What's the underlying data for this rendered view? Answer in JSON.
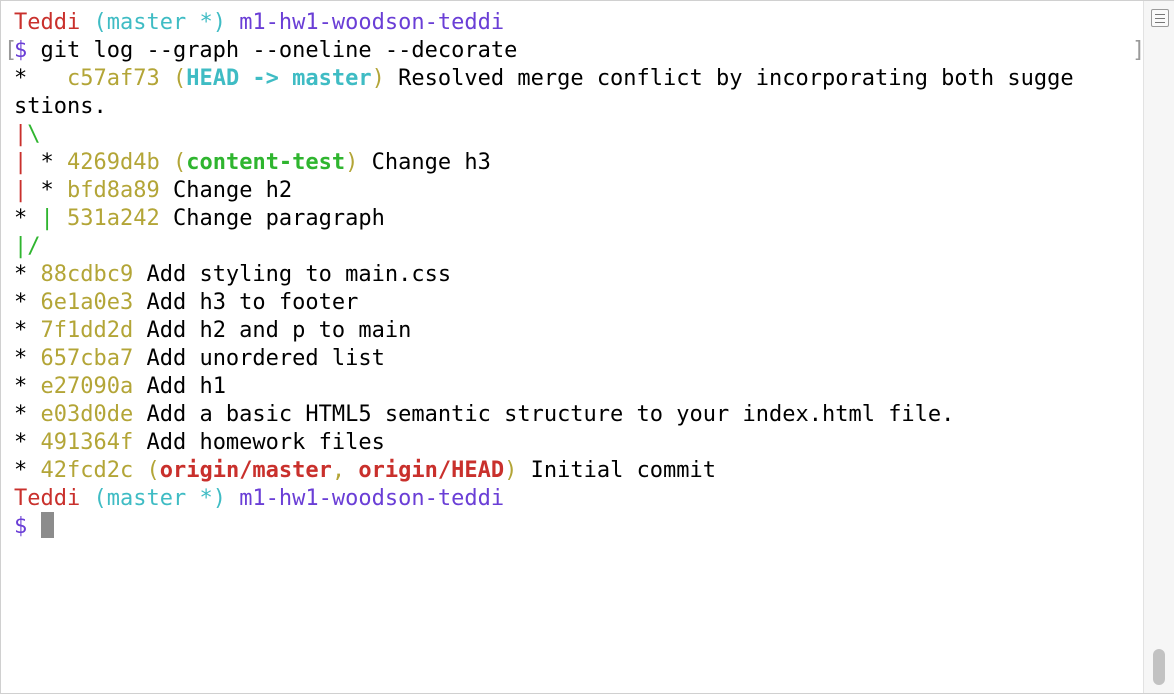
{
  "terminal": {
    "prompt1": {
      "user": "Teddi",
      "branch": "(master *)",
      "dir": "m1-hw1-woodson-teddi"
    },
    "command": {
      "dollar": "$",
      "text": " git log --graph --oneline --decorate"
    },
    "commit_head": {
      "graph": "*   ",
      "hash": "c57af73",
      "paren_open": " (",
      "head_ref": "HEAD -> master",
      "paren_close": ")",
      "message": " Resolved merge conflict by incorporating both sugge"
    },
    "commit_head_wrap": "stions.",
    "graph_merge": {
      "pipe": "|",
      "backslash": "\\"
    },
    "commit_content": {
      "pipe": "|",
      "graph": " * ",
      "hash": "4269d4b",
      "paren_open": " (",
      "ref": "content-test",
      "paren_close": ")",
      "message": " Change h3"
    },
    "commit_h2": {
      "pipe": "|",
      "graph": " * ",
      "hash": "bfd8a89",
      "message": " Change h2"
    },
    "commit_paragraph": {
      "star": "* ",
      "pipe": "|",
      "hash": " 531a242",
      "message": " Change paragraph"
    },
    "graph_split": {
      "pipe": "|",
      "slash": "/"
    },
    "commits": [
      {
        "graph": "* ",
        "hash": "88cdbc9",
        "message": " Add styling to main.css"
      },
      {
        "graph": "* ",
        "hash": "6e1a0e3",
        "message": " Add h3 to footer"
      },
      {
        "graph": "* ",
        "hash": "7f1dd2d",
        "message": " Add h2 and p to main"
      },
      {
        "graph": "* ",
        "hash": "657cba7",
        "message": " Add unordered list"
      },
      {
        "graph": "* ",
        "hash": "e27090a",
        "message": " Add h1"
      },
      {
        "graph": "* ",
        "hash": "e03d0de",
        "message": " Add a basic HTML5 semantic structure to your index.html file."
      },
      {
        "graph": "* ",
        "hash": "491364f",
        "message": " Add homework files"
      }
    ],
    "commit_initial": {
      "graph": "* ",
      "hash": "42fcd2c",
      "paren_open": " (",
      "ref1": "origin/master",
      "comma": ", ",
      "ref2": "origin/HEAD",
      "paren_close": ")",
      "message": " Initial commit"
    },
    "prompt2": {
      "user": "Teddi",
      "branch": "(master *)",
      "dir": "m1-hw1-woodson-teddi"
    },
    "input_dollar": "$",
    "colors": {
      "user": "#c9302c",
      "branch": "#3fbcc4",
      "dir": "#6a3ed6",
      "hash": "#b3a537",
      "local_branch": "#2fb52f",
      "remote_ref": "#c9302c"
    }
  }
}
